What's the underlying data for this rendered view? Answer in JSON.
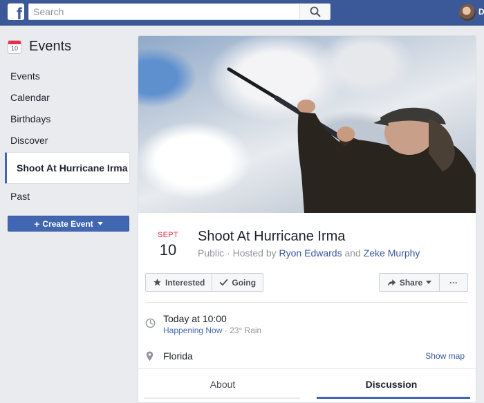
{
  "topbar": {
    "logo_letter": "f",
    "search_placeholder": "Search",
    "user_initial": "D"
  },
  "sidebar": {
    "title": "Events",
    "calendar_icon_day": "10",
    "items": [
      {
        "label": "Events",
        "active": false
      },
      {
        "label": "Calendar",
        "active": false
      },
      {
        "label": "Birthdays",
        "active": false
      },
      {
        "label": "Discover",
        "active": false
      },
      {
        "label": "Shoot At Hurricane Irma",
        "active": true
      },
      {
        "label": "Past",
        "active": false
      }
    ],
    "create_button": {
      "plus": "+",
      "label": "Create Event"
    }
  },
  "event": {
    "month": "SEPT",
    "day": "10",
    "title": "Shoot At Hurricane Irma",
    "visibility": "Public",
    "hosted_by_label": "Hosted by",
    "host_1": "Ryon Edwards",
    "host_joiner": "and",
    "host_2": "Zeke Murphy",
    "actions": {
      "interested": "Interested",
      "going": "Going",
      "share": "Share",
      "more": "···"
    },
    "time": {
      "main": "Today at 10:00",
      "status": "Happening Now",
      "weather": "23° Rain"
    },
    "location": {
      "name": "Florida",
      "show_map": "Show map"
    },
    "tabs": [
      {
        "label": "About",
        "active": false
      },
      {
        "label": "Discussion",
        "active": true
      }
    ]
  },
  "colors": {
    "brand": "#3b5998",
    "accent": "#4267b2",
    "link": "#365899",
    "date_month": "#f02849"
  }
}
